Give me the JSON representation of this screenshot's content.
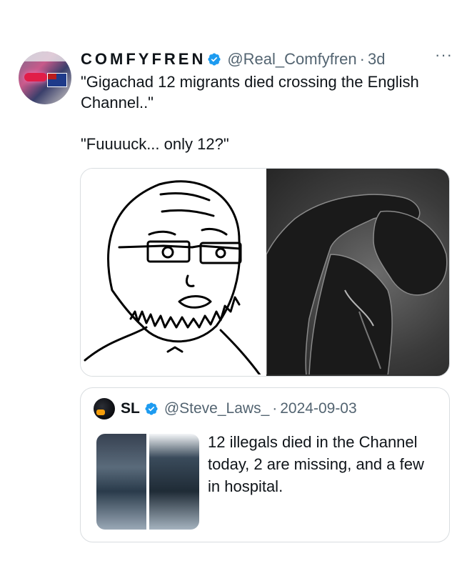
{
  "tweet": {
    "display_name": "COMFYFREN",
    "handle": "@Real_Comfyfren",
    "separator": "·",
    "time": "3d",
    "more": "···",
    "text": "\"Gigachad 12 migrants died crossing the English Channel..\"\n\n\"Fuuuuck... only 12?\""
  },
  "quote": {
    "display_name": "SL",
    "handle": "@Steve_Laws_",
    "separator": "·",
    "date": "2024-09-03",
    "text": "12 illegals died in the Channel today, 2 are missing, and a few in hospital."
  },
  "icons": {
    "verified": "verified-badge-icon",
    "more": "more-options-icon"
  },
  "colors": {
    "verified_blue": "#1d9bf0",
    "secondary_text": "#536471",
    "border": "#d9dde0"
  }
}
